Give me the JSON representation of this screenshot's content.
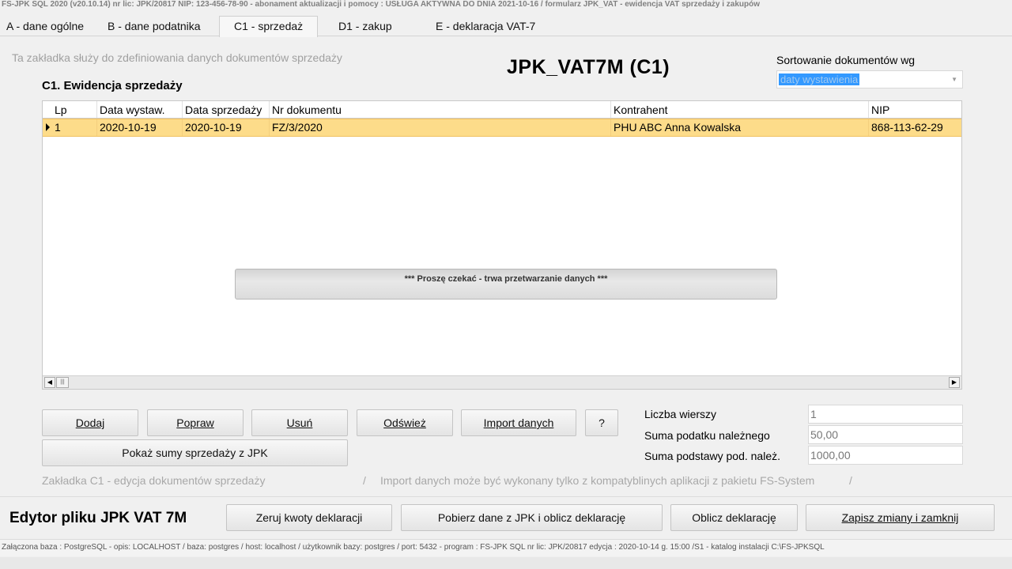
{
  "titlebar": "FS-JPK SQL 2020  (v20.10.14)     nr lic: JPK/20817     NIP: 123-456-78-90     -  abonament aktualizacji i pomocy : USŁUGA AKTYWNA DO DNIA 2021-10-16     /     formularz JPK_VAT  - ewidencja VAT sprzedaży i zakupów",
  "tabs": [
    {
      "label": "A - dane ogólne"
    },
    {
      "label": "B   - dane podatnika"
    },
    {
      "label": "C1  - sprzedaż"
    },
    {
      "label": "D1   - zakup"
    },
    {
      "label": "E - deklaracja VAT-7"
    }
  ],
  "panel": {
    "hint": "Ta zakładka służy do zdefiniowania danych dokumentów sprzedaży",
    "title": "JPK_VAT7M  (C1)",
    "sort_label": "Sortowanie dokumentów wg",
    "sort_value": "daty wystawienia",
    "section_title": "C1. Ewidencja sprzedaży"
  },
  "grid": {
    "columns": [
      "Lp",
      "Data wystaw.",
      "Data sprzedaży",
      "Nr dokumentu",
      "Kontrahent",
      "NIP"
    ],
    "rows": [
      [
        "1",
        "2020-10-19",
        "2020-10-19",
        "FZ/3/2020",
        "PHU ABC Anna Kowalska",
        "868-113-62-29"
      ]
    ]
  },
  "progress_message": "***  Proszę czekać -  trwa przetwarzanie danych  ***",
  "buttons": {
    "add": "Dodaj",
    "edit": "Popraw",
    "delete": "Usuń",
    "refresh": "Odśwież",
    "import": "Import danych",
    "help": "?",
    "show_sums": "Pokaż sumy sprzedaży z JPK"
  },
  "stats": {
    "rows_label": "Liczba wierszy",
    "rows_value": "1",
    "tax_label": "Suma podatku należnego",
    "tax_value": "50,00",
    "base_label": "Suma podstawy pod. należ.",
    "base_value": "1000,00"
  },
  "footer": {
    "left": "Zakładka C1 - edycja dokumentów sprzedaży",
    "sep1": "/",
    "right": "Import danych może być wykonany tylko z kompatyblinych aplikacji z pakietu FS-System",
    "sep2": "/"
  },
  "bottom": {
    "editor_title": "Edytor pliku JPK VAT 7M",
    "reset": "Zeruj kwoty deklaracji",
    "fetch": "Pobierz dane z JPK i oblicz deklarację",
    "calc": "Oblicz deklarację",
    "save": "Zapisz zmiany i zamknij"
  },
  "statusbar": "Załączona baza : PostgreSQL - opis: LOCALHOST  /  baza: postgres / host: localhost / użytkownik bazy: postgres /  port: 5432  -  program :  FS-JPK SQL  nr lic: JPK/20817  edycja : 2020-10-14 g. 15:00 /S1 - katalog instalacji C:\\FS-JPKSQL"
}
